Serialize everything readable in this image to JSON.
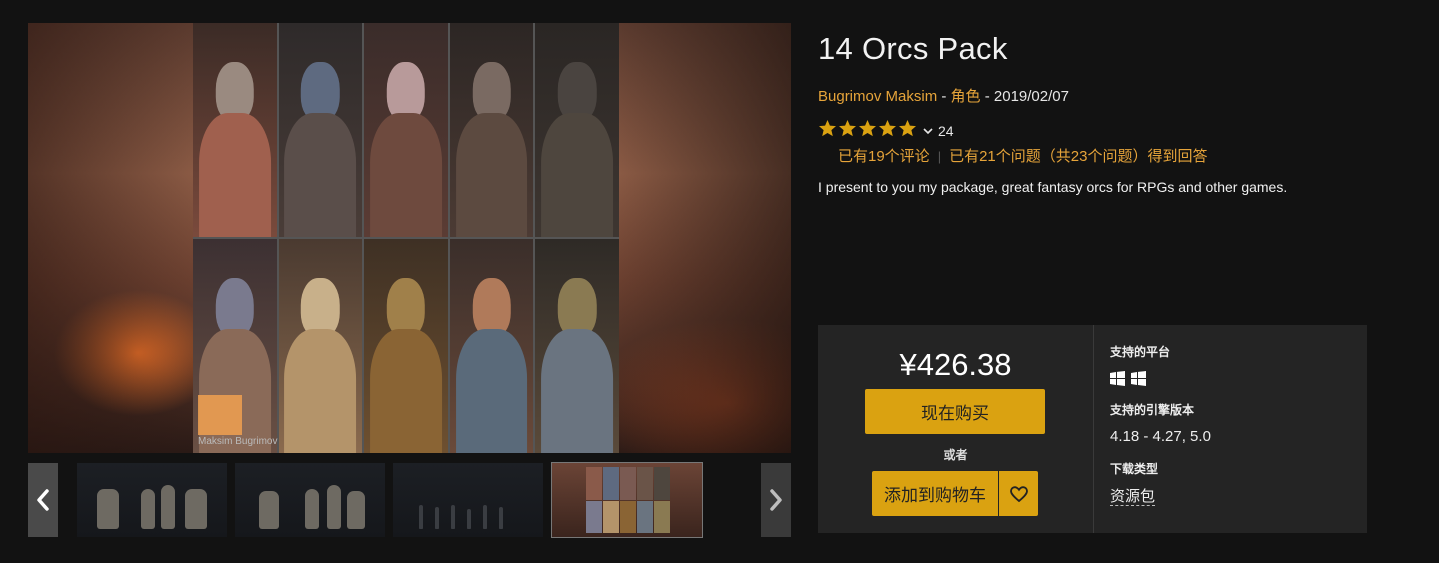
{
  "product": {
    "title": "14 Orcs Pack",
    "author": "Bugrimov Maksim",
    "category": "角色",
    "date": "2019/02/07",
    "meta_separator": " - ",
    "rating": {
      "stars": 5,
      "max": 5,
      "count": "24"
    },
    "reviews_link": "已有19个评论",
    "questions_link": "已有21个问题（共23个问题）得到回答",
    "description": "I present to you my package, great fantasy orcs for RPGs and other games."
  },
  "gallery": {
    "watermark_text": "Maksim Bugrimov",
    "thumbnails": [
      {
        "name": "thumb-1"
      },
      {
        "name": "thumb-2"
      },
      {
        "name": "thumb-3"
      },
      {
        "name": "thumb-4",
        "selected": true
      }
    ]
  },
  "purchase": {
    "price": "¥426.38",
    "buy_label": "现在购买",
    "or_label": "或者",
    "cart_label": "添加到购物车"
  },
  "info": {
    "platforms_label": "支持的平台",
    "platform_icons": [
      "windows-icon",
      "windows-icon"
    ],
    "engine_label": "支持的引擎版本",
    "engine_versions": "4.18 - 4.27, 5.0",
    "download_label": "下载类型",
    "download_type": "资源包"
  },
  "colors": {
    "accent": "#daa211",
    "link": "#e6a43a",
    "background": "#121212",
    "panel": "#242424"
  }
}
